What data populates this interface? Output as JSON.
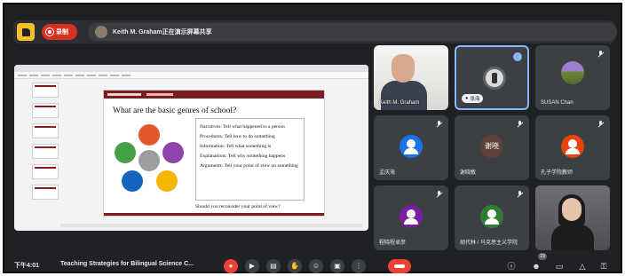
{
  "top_bar": {
    "recording_label": "录制",
    "presenter_label": "Keith M. Graham正在演示屏幕共享"
  },
  "slide": {
    "header_main": "",
    "header_sub": "",
    "title": "What are the basic genres of school?",
    "genres": [
      "Narratives: Tell what happened to a person",
      "Procedures: Tell how to do something",
      "Information: Tell what something is",
      "Explanations: Tell why something happens",
      "Arguments: Tell your point of view on something"
    ],
    "question": "Should you reconsider your point of view?",
    "wheel_colors": [
      "#e4572e",
      "#8e44ad",
      "#f4b400",
      "#1565c0",
      "#43a047"
    ]
  },
  "participants": [
    {
      "name": "Keith M. Graham",
      "type": "video",
      "muted": false
    },
    {
      "name": "张海",
      "type": "self",
      "muted": false,
      "speaking": true
    },
    {
      "name": "SUSAN Chan",
      "type": "avatar",
      "avatar_color": "#6b8a3a",
      "muted": true
    },
    {
      "name": "孟庆海",
      "type": "avatar",
      "avatar_color": "#1a73e8",
      "muted": true
    },
    {
      "name": "谢晓敏",
      "type": "avatar",
      "avatar_color": "#5d4037",
      "initials": "谢晓",
      "muted": true
    },
    {
      "name": "孔子学院教师",
      "type": "avatar",
      "avatar_color": "#e8430a",
      "muted": true
    },
    {
      "name": "程晓程卓彦",
      "type": "avatar",
      "avatar_color": "#7b1fa2",
      "muted": true
    },
    {
      "name": "胡代林 / 马克思主义学院",
      "type": "avatar",
      "avatar_color": "#2e7d32",
      "muted": true
    },
    {
      "name": "",
      "type": "video",
      "muted": false
    }
  ],
  "bottom_bar": {
    "time": "下午4:01",
    "meeting_title": "Teaching Strategies for Bilingual Science C...",
    "participant_count": "19",
    "controls": [
      "mic-off",
      "camera",
      "captions",
      "raise-hand",
      "emoji",
      "present",
      "more",
      "hangup"
    ],
    "right_controls": [
      "info",
      "people",
      "chat",
      "activities",
      "host-controls"
    ]
  },
  "colors": {
    "background": "#202124",
    "tile": "#3c4043",
    "danger": "#ea4335",
    "accent": "#8ab4f8",
    "slide_brand": "#7a1c20"
  }
}
